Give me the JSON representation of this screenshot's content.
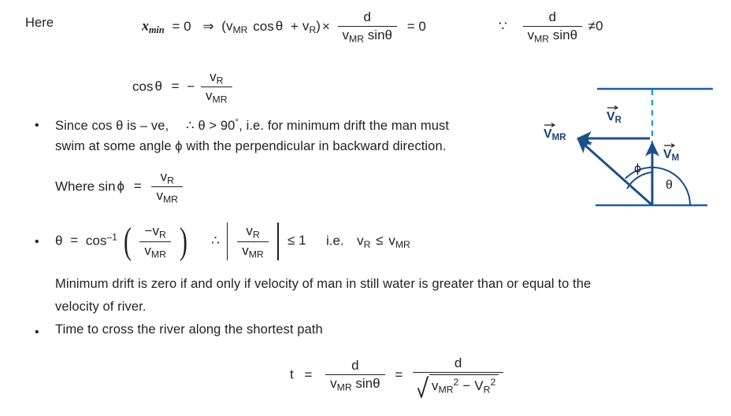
{
  "document": {
    "title": "Minimum drift river crossing derivation",
    "text_color": "#231f20",
    "accent_color": "#1b5ea8",
    "vector_color": "#1b3f77"
  },
  "line1": {
    "here_label": "Here",
    "x_symbol": "x",
    "x_sub": "min",
    "eq1": "= 0",
    "implies": "⇒",
    "open_paren": "(",
    "v_mr": "v",
    "v_mr_sub": "MR",
    "cos": "cos",
    "theta": "θ",
    "plus": "+",
    "v_r": "v",
    "v_r_sub": "R",
    "close_paren": ")",
    "times": "×",
    "frac_num": "d",
    "frac_den_v": "v",
    "frac_den_sub": "MR",
    "frac_den_sin": "sin",
    "frac_den_theta": "θ",
    "equals_zero": "= 0",
    "because": "∵",
    "not_equal_zero": "≠0"
  },
  "line2": {
    "cos": "cos",
    "theta": "θ",
    "equals": "=",
    "minus": "−",
    "num_v": "v",
    "num_sub": "R",
    "den_v": "v",
    "den_sub": "MR"
  },
  "bullet1": {
    "marker": "•",
    "text_a": "Since cos θ is – ve,",
    "text_b": "∴  θ > 90",
    "degree": "°",
    "text_c": ", i.e. for minimum drift the man must",
    "line2": "swim at some angle ϕ with the perpendicular in backward direction."
  },
  "line3": {
    "where": "Where sin",
    "phi": "ϕ",
    "equals": "=",
    "num_v": "v",
    "num_sub": "R",
    "den_v": "v",
    "den_sub": "MR"
  },
  "bullet2": {
    "marker": "•",
    "theta": "θ",
    "equals": "=",
    "cos": "cos",
    "inv": "–1",
    "paren_open": "(",
    "paren_close": ")",
    "num_minus": "−",
    "num_v": "v",
    "num_sub": "R",
    "den_v": "v",
    "den_sub": "MR",
    "therefore": "∴",
    "abs_num_v": "v",
    "abs_num_sub": "R",
    "abs_den_v": "v",
    "abs_den_sub": "MR",
    "le_one": "≤ 1",
    "ie": "i.e.",
    "ie_v_r": "v",
    "ie_v_r_sub": "R",
    "ie_le": "≤",
    "ie_v_mr": "v",
    "ie_v_mr_sub": "MR"
  },
  "paragraph": {
    "line1": "Minimum drift is zero if and only if velocity of man in still water is greater than or equal to the",
    "line2": "velocity of river."
  },
  "bullet3": {
    "marker": "•",
    "text": "Time to cross the river along the shortest path"
  },
  "final_eq": {
    "t": "t",
    "equals1": "=",
    "num1": "d",
    "den1_v": "v",
    "den1_sub": "MR",
    "den1_sin": "sin",
    "den1_theta": "θ",
    "equals2": "=",
    "num2": "d",
    "den2_v1": "v",
    "den2_sub1": "MR",
    "den2_sup1": "2",
    "den2_minus": "−",
    "den2_v2": "V",
    "den2_sub2": "R",
    "den2_sup2": "2"
  },
  "diagram": {
    "label_vr": "V",
    "label_vr_sub": "R",
    "label_vmr": "V",
    "label_vmr_sub": "MR",
    "label_vm": "V",
    "label_vm_sub": "M",
    "angle_phi": "ϕ",
    "angle_theta": "θ",
    "line_color": "#1b5ea8",
    "vector_color": "#1b4f8a"
  }
}
